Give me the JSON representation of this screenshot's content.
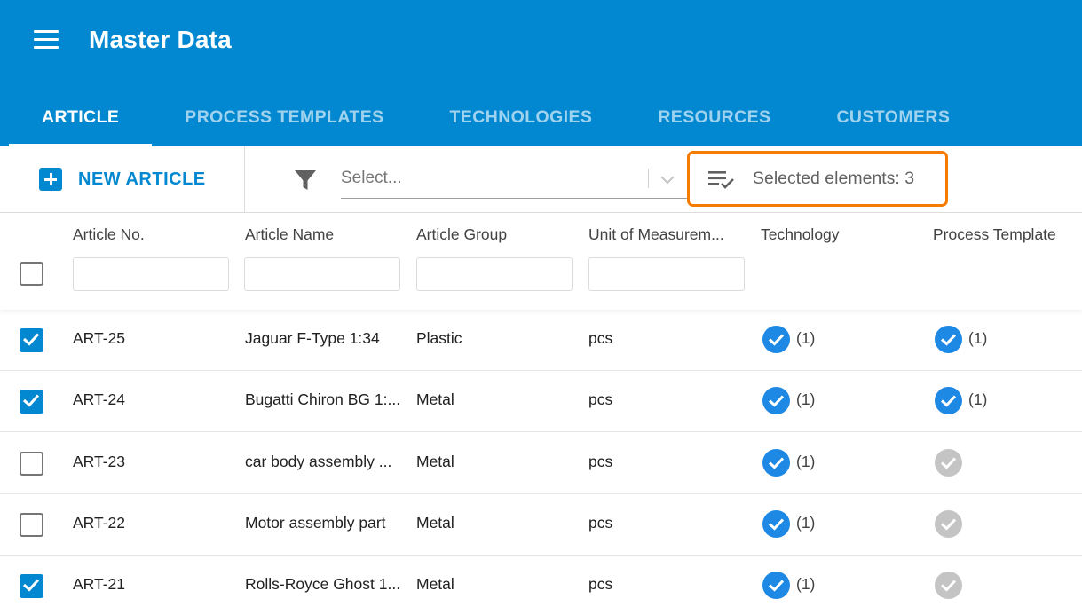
{
  "header": {
    "title": "Master Data",
    "menu_icon": "hamburger-menu-icon",
    "background": "#0288d1"
  },
  "tabs": [
    {
      "label": "ARTICLE",
      "active": true
    },
    {
      "label": "PROCESS TEMPLATES",
      "active": false
    },
    {
      "label": "TECHNOLOGIES",
      "active": false
    },
    {
      "label": "RESOURCES",
      "active": false
    },
    {
      "label": "CUSTOMERS",
      "active": false
    }
  ],
  "toolbar": {
    "new_button_label": "NEW ARTICLE",
    "filter_placeholder": "Select...",
    "selected_elements": "Selected elements: 3",
    "highlight_color": "#f57c00"
  },
  "table": {
    "columns": [
      "Article No.",
      "Article Name",
      "Article Group",
      "Unit of Measurem...",
      "Technology",
      "Process Template"
    ],
    "header_checkbox_checked": false,
    "rows": [
      {
        "checked": true,
        "article_no": "ART-25",
        "name": "Jaguar F-Type 1:34",
        "group": "Plastic",
        "unit": "pcs",
        "technology": {
          "assigned": true,
          "count": "(1)"
        },
        "process_template": {
          "assigned": true,
          "count": "(1)"
        }
      },
      {
        "checked": true,
        "article_no": "ART-24",
        "name": "Bugatti Chiron BG 1:...",
        "group": "Metal",
        "unit": "pcs",
        "technology": {
          "assigned": true,
          "count": "(1)"
        },
        "process_template": {
          "assigned": true,
          "count": "(1)"
        }
      },
      {
        "checked": false,
        "article_no": "ART-23",
        "name": "car body assembly ...",
        "group": "Metal",
        "unit": "pcs",
        "technology": {
          "assigned": true,
          "count": "(1)"
        },
        "process_template": {
          "assigned": false,
          "count": ""
        }
      },
      {
        "checked": false,
        "article_no": "ART-22",
        "name": "Motor assembly part",
        "group": "Metal",
        "unit": "pcs",
        "technology": {
          "assigned": true,
          "count": "(1)"
        },
        "process_template": {
          "assigned": false,
          "count": ""
        }
      },
      {
        "checked": true,
        "article_no": "ART-21",
        "name": "Rolls-Royce Ghost 1...",
        "group": "Metal",
        "unit": "pcs",
        "technology": {
          "assigned": true,
          "count": "(1)"
        },
        "process_template": {
          "assigned": false,
          "count": ""
        }
      }
    ]
  }
}
